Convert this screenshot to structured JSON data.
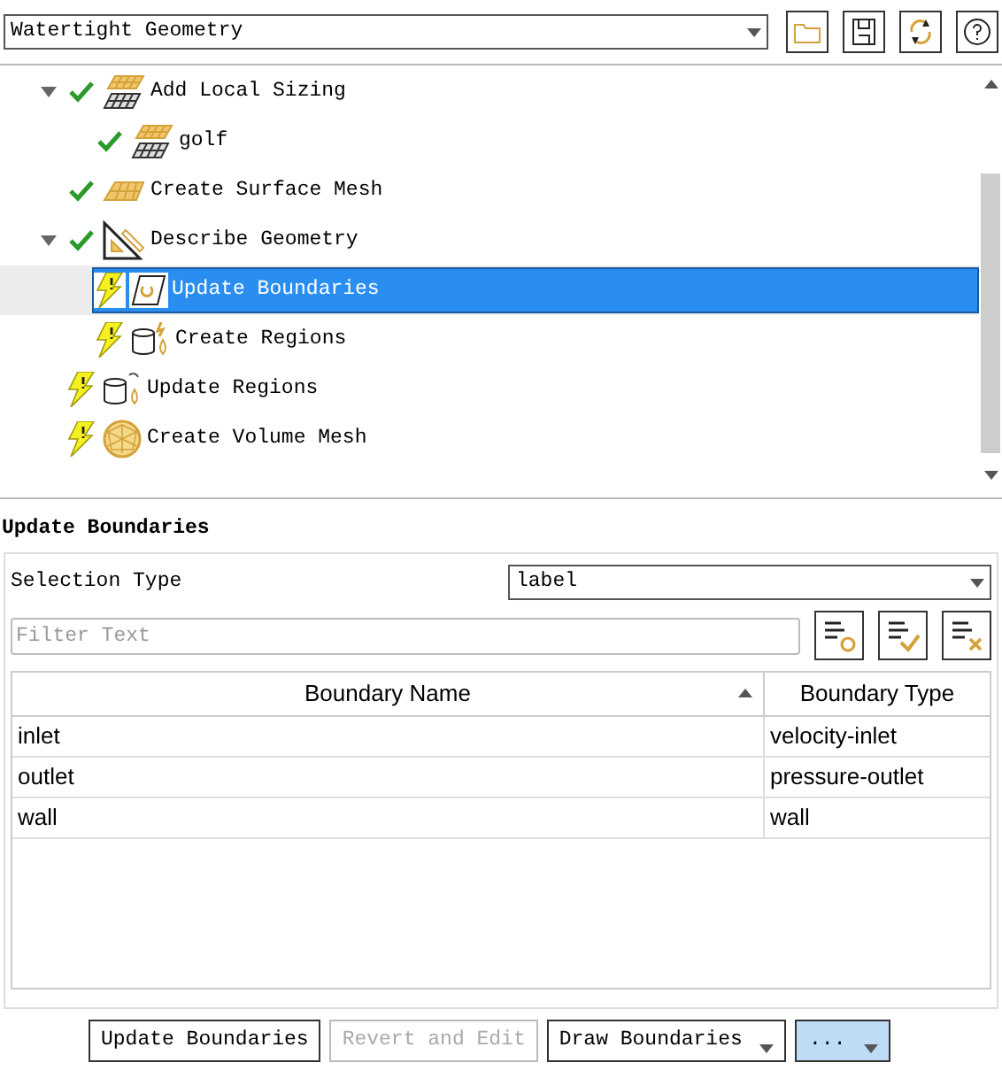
{
  "workflow_select": {
    "value": "Watertight Geometry"
  },
  "tree": [
    {
      "label": "Add Local Sizing",
      "kind": "sizing",
      "done": true,
      "expanded": true,
      "selected": false,
      "children": [
        {
          "label": "golf",
          "kind": "sizing",
          "done": true,
          "selected": false
        }
      ]
    },
    {
      "label": "Create Surface Mesh",
      "kind": "surface-mesh",
      "done": true,
      "selected": false
    },
    {
      "label": "Describe Geometry",
      "kind": "geometry",
      "done": true,
      "expanded": true,
      "selected": false,
      "children": [
        {
          "label": "Update Boundaries",
          "kind": "boundaries",
          "done": false,
          "selected": true
        },
        {
          "label": "Create Regions",
          "kind": "regions",
          "done": false,
          "selected": false
        }
      ]
    },
    {
      "label": "Update Regions",
      "kind": "update-regions",
      "done": false,
      "selected": false
    },
    {
      "label": "Create Volume Mesh",
      "kind": "volume-mesh",
      "done": false,
      "selected": false
    }
  ],
  "panel": {
    "title": "Update Boundaries",
    "selection_type_label": "Selection Type",
    "selection_type": "label",
    "filter": {
      "placeholder": "Filter Text"
    },
    "table": {
      "columns": [
        "Boundary Name",
        "Boundary Type"
      ],
      "rows": [
        [
          "inlet",
          "velocity-inlet"
        ],
        [
          "outlet",
          "pressure-outlet"
        ],
        [
          "wall",
          "wall"
        ]
      ]
    }
  },
  "buttons": [
    {
      "label": "Update Boundaries",
      "kind": "plain",
      "disabled": false
    },
    {
      "label": "Revert and Edit",
      "kind": "plain",
      "disabled": true
    },
    {
      "label": "Draw Boundaries",
      "kind": "menu",
      "disabled": false
    },
    {
      "label": "...",
      "kind": "accent-menu",
      "disabled": false
    }
  ]
}
